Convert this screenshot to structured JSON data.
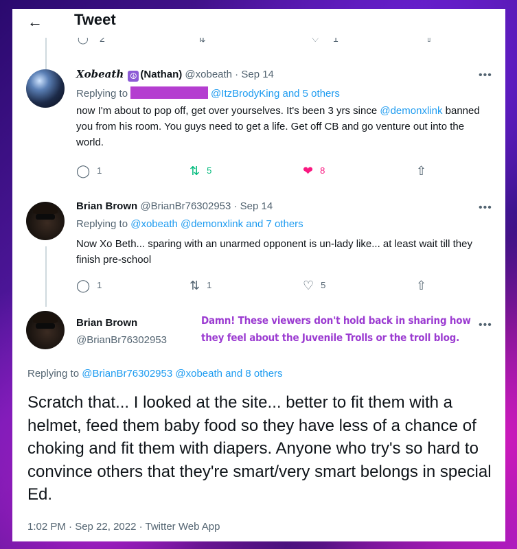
{
  "header": {
    "back_icon": "arrow-left-icon",
    "title": "Tweet"
  },
  "top_clipped_actions": {
    "reply_count": "2",
    "like_count": "1"
  },
  "tweets": [
    {
      "name": "𝑿𝒐𝒃𝒆𝒂𝒕𝒉",
      "name_suffix": "(Nathan)",
      "handle": "@xobeath · Sep 14",
      "replying_prefix": "Replying to",
      "replying_to": "@ItzBrodyKing and 5 others",
      "body_parts": [
        "now I'm about to pop off, get over yourselves. It's been 3 yrs since ",
        "@demonxlink",
        " banned you from his room. You guys need to get a life. Get off CB and go venture out into the world."
      ],
      "replies": "1",
      "retweets": "5",
      "likes": "8"
    },
    {
      "name": "Brian Brown",
      "handle": "@BrianBr76302953 · Sep 14",
      "replying_prefix": "Replying to",
      "replying_to": "@xobeath @demonxlink and 7 others",
      "body": "Now Xo Beth... sparing with an unarmed opponent is un-lady like... at least wait till they finish pre-school",
      "replies": "1",
      "retweets": "1",
      "likes": "5"
    }
  ],
  "main_tweet": {
    "name": "Brian Brown",
    "handle": "@BrianBr76302953",
    "replying_prefix": "Replying to",
    "replying_to": "@BrianBr76302953 @xobeath and 8 others",
    "body": "Scratch that... I looked at the site... better to fit them with a helmet, feed them baby food so they have less of a chance of choking and fit them with diapers. Anyone who try's so hard to convince others that they're smart/very smart belongs in special Ed.",
    "timestamp": "1:02 PM · Sep 22, 2022 · Twitter Web App"
  },
  "annotation": {
    "line1": "Damn! These viewers don't hold back in sharing how",
    "line2": "they feel about the Juvenile Trolls or the troll blog."
  },
  "colors": {
    "link": "#1d9bf0",
    "retweet_active": "#00ba7c",
    "like_active": "#f91880",
    "annotation": "#9b3bd1",
    "redaction": "#b43ed0"
  }
}
